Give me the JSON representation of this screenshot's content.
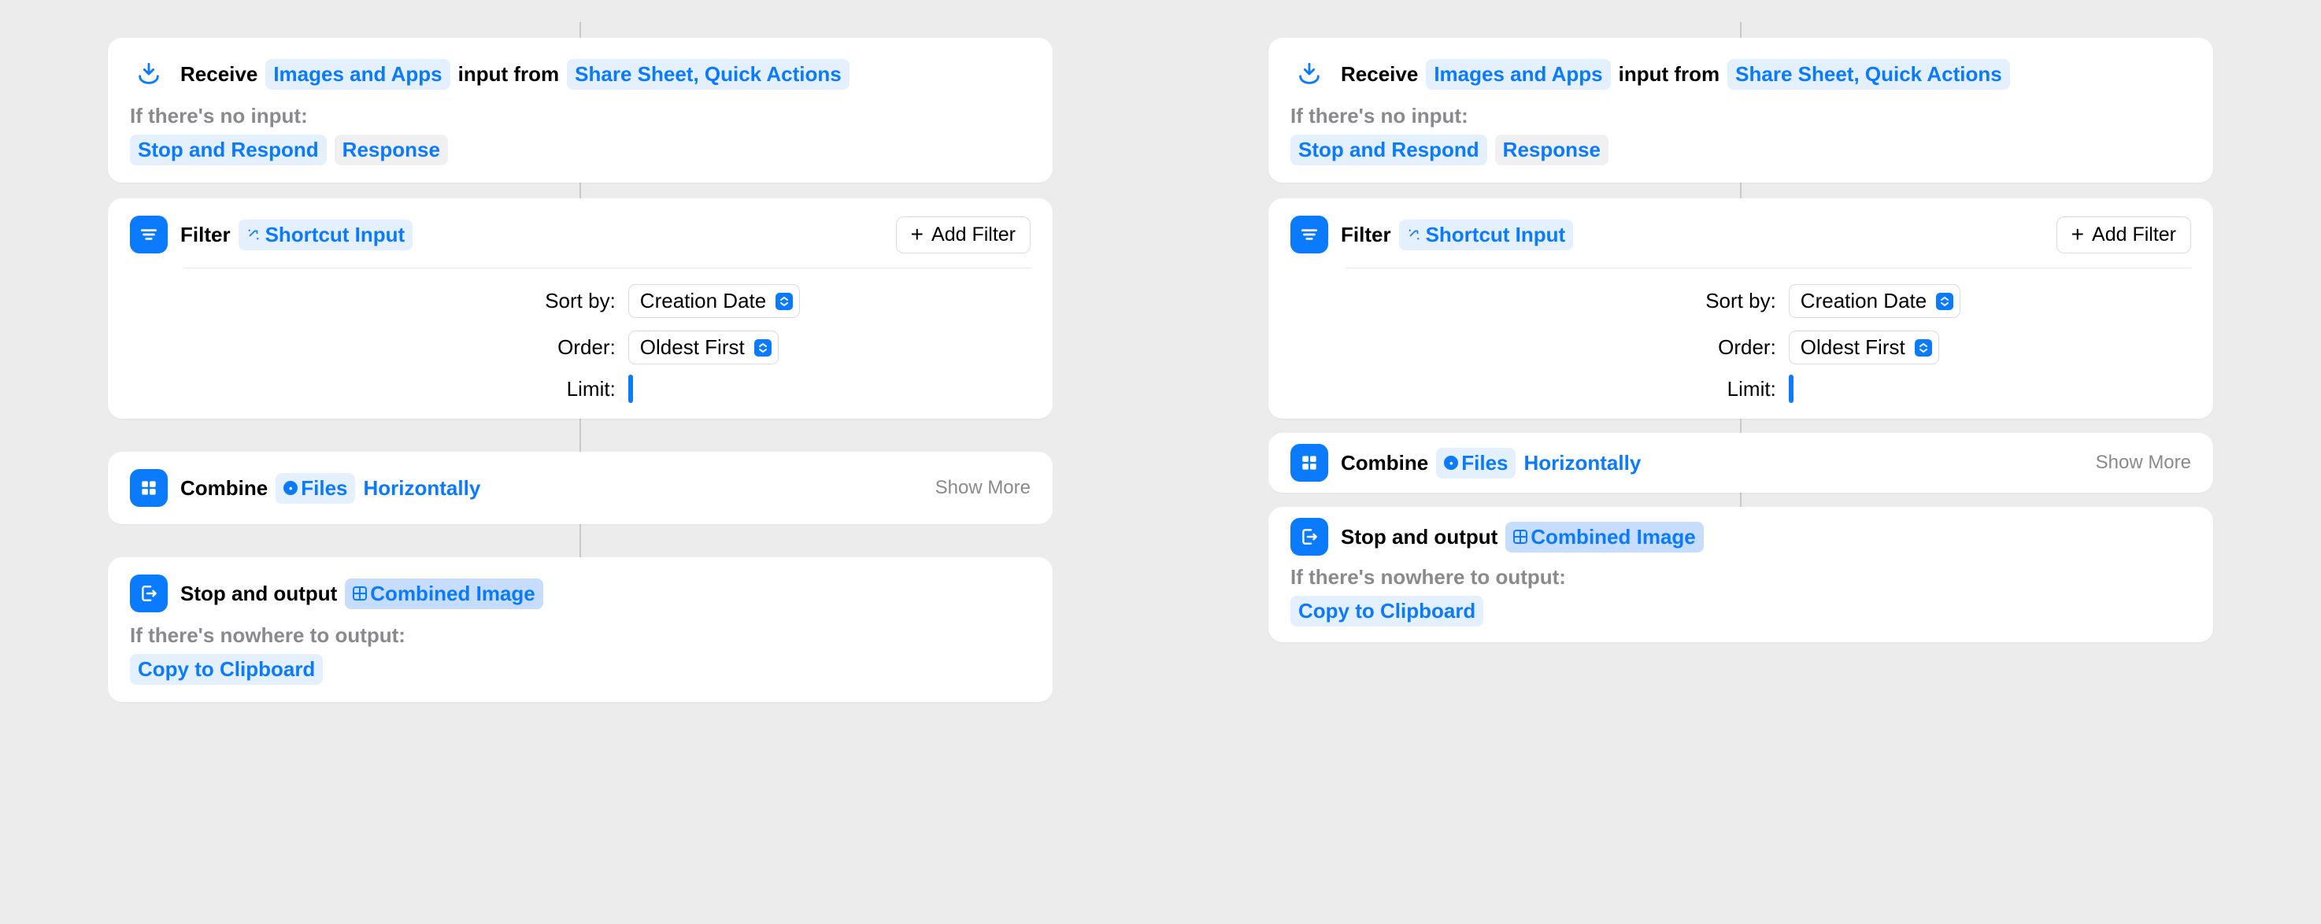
{
  "colors": {
    "accent": "#0a7aff",
    "bg": "#ececec",
    "card": "#ffffff",
    "muted": "#8a8a8e"
  },
  "receive": {
    "title": "Receive",
    "types": "Images and Apps",
    "middle": "input from",
    "sources": "Share Sheet, Quick Actions",
    "noInputLabel": "If there's no input:",
    "noInputAction": "Stop and Respond",
    "noInputResponse": "Response"
  },
  "filter": {
    "title": "Filter",
    "param": "Shortcut Input",
    "addFilter": "Add Filter",
    "sortByLabel": "Sort by:",
    "sortByValue": "Creation Date",
    "orderLabel": "Order:",
    "orderValue": "Oldest First",
    "limitLabel": "Limit:"
  },
  "combine": {
    "title": "Combine",
    "param": "Files",
    "mode": "Horizontally",
    "showMore": "Show More"
  },
  "output": {
    "title": "Stop and output",
    "param": "Combined Image",
    "nowhereLabel": "If there's nowhere to output:",
    "fallback": "Copy to Clipboard"
  },
  "panes": [
    {
      "combineCompact": false,
      "outputCompact": false
    },
    {
      "combineCompact": true,
      "outputCompact": true
    }
  ]
}
